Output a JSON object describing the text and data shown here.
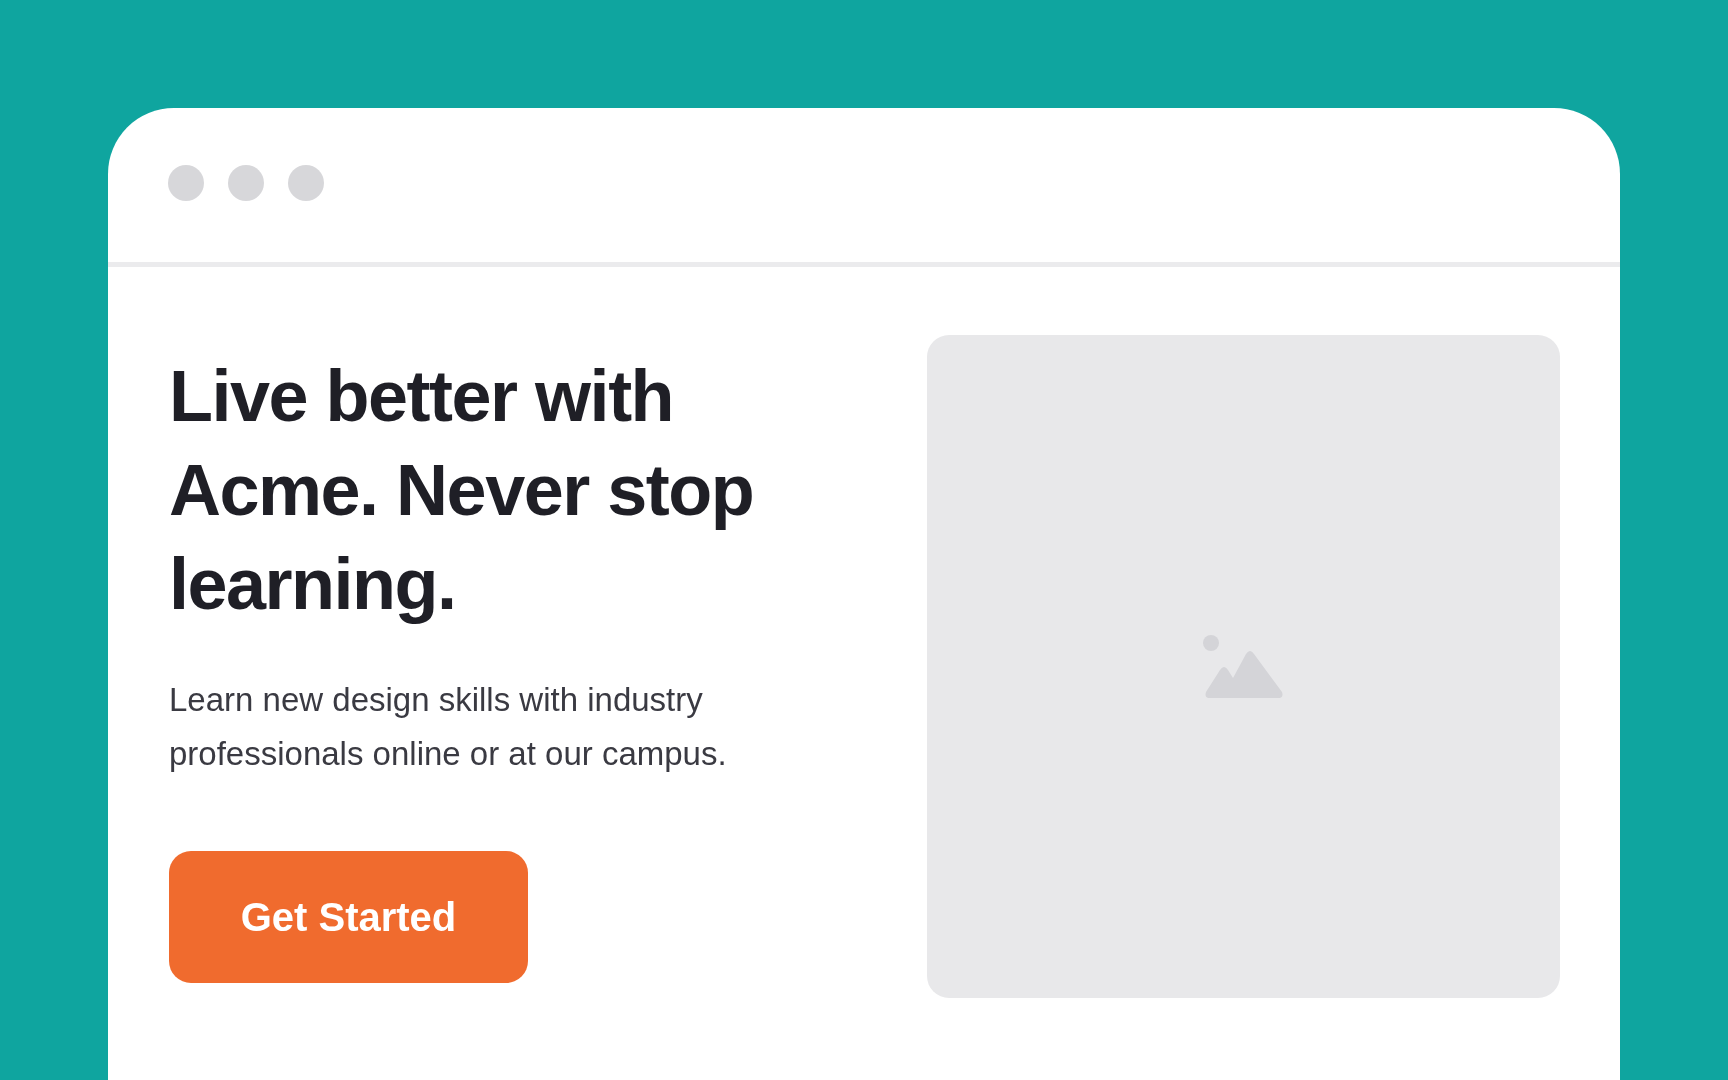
{
  "hero": {
    "headline": "Live better with Acme. Never stop learning.",
    "description": "Learn new design skills with industry professionals online or at our campus.",
    "button": "Get Started"
  },
  "media": {
    "kind": "placeholder"
  }
}
